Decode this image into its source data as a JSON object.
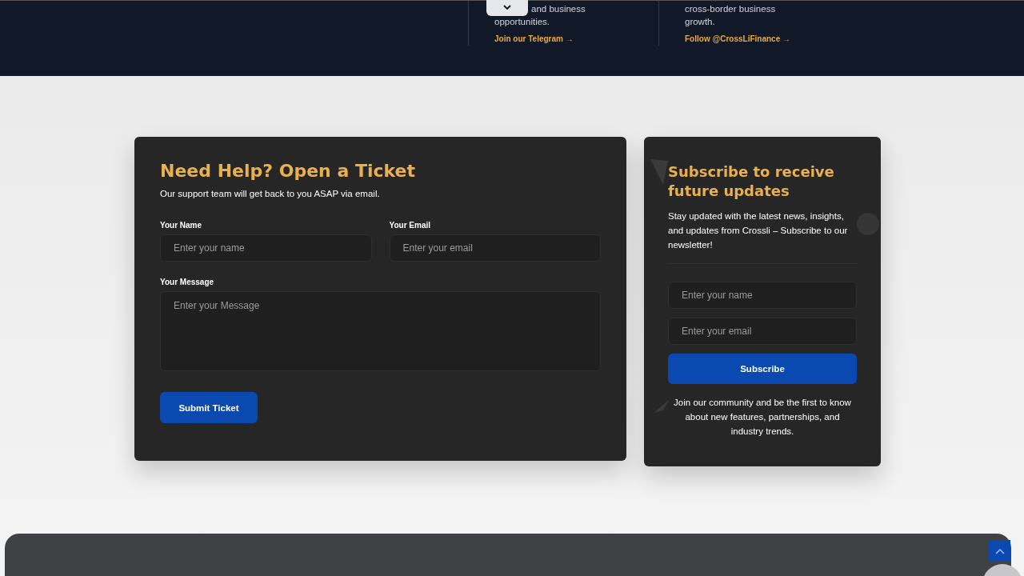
{
  "top_band": {
    "columns": [
      {
        "lines": [
          "and business",
          "opportunities."
        ],
        "link": "Join our Telegram",
        "link_arrow": "→"
      },
      {
        "lines": [
          "cross-border business growth."
        ],
        "link": "Follow @CrossLiFinance",
        "link_arrow": "→"
      }
    ]
  },
  "ticket_form": {
    "title": "Need Help? Open a Ticket",
    "subtitle": "Our support team will get back to you ASAP via email.",
    "fields": [
      {
        "label": "Your Name",
        "placeholder": "Enter your name",
        "kind": "input"
      },
      {
        "label": "Your Email",
        "placeholder": "Enter your email",
        "kind": "input"
      },
      {
        "label": "Your Message",
        "placeholder": "Enter your Message",
        "kind": "textarea"
      }
    ],
    "button": "Submit Ticket"
  },
  "newsletter": {
    "title": "Subscribe to receive future updates",
    "description": "Stay updated with the latest news, insights, and updates from Crossli – Subscribe to our newsletter!",
    "fields": [
      {
        "placeholder": "Enter your name"
      },
      {
        "placeholder": "Enter your email"
      }
    ],
    "button": "Subscribe",
    "footer": "Join our community and be the first to know about new features, partnerships, and industry trends."
  }
}
